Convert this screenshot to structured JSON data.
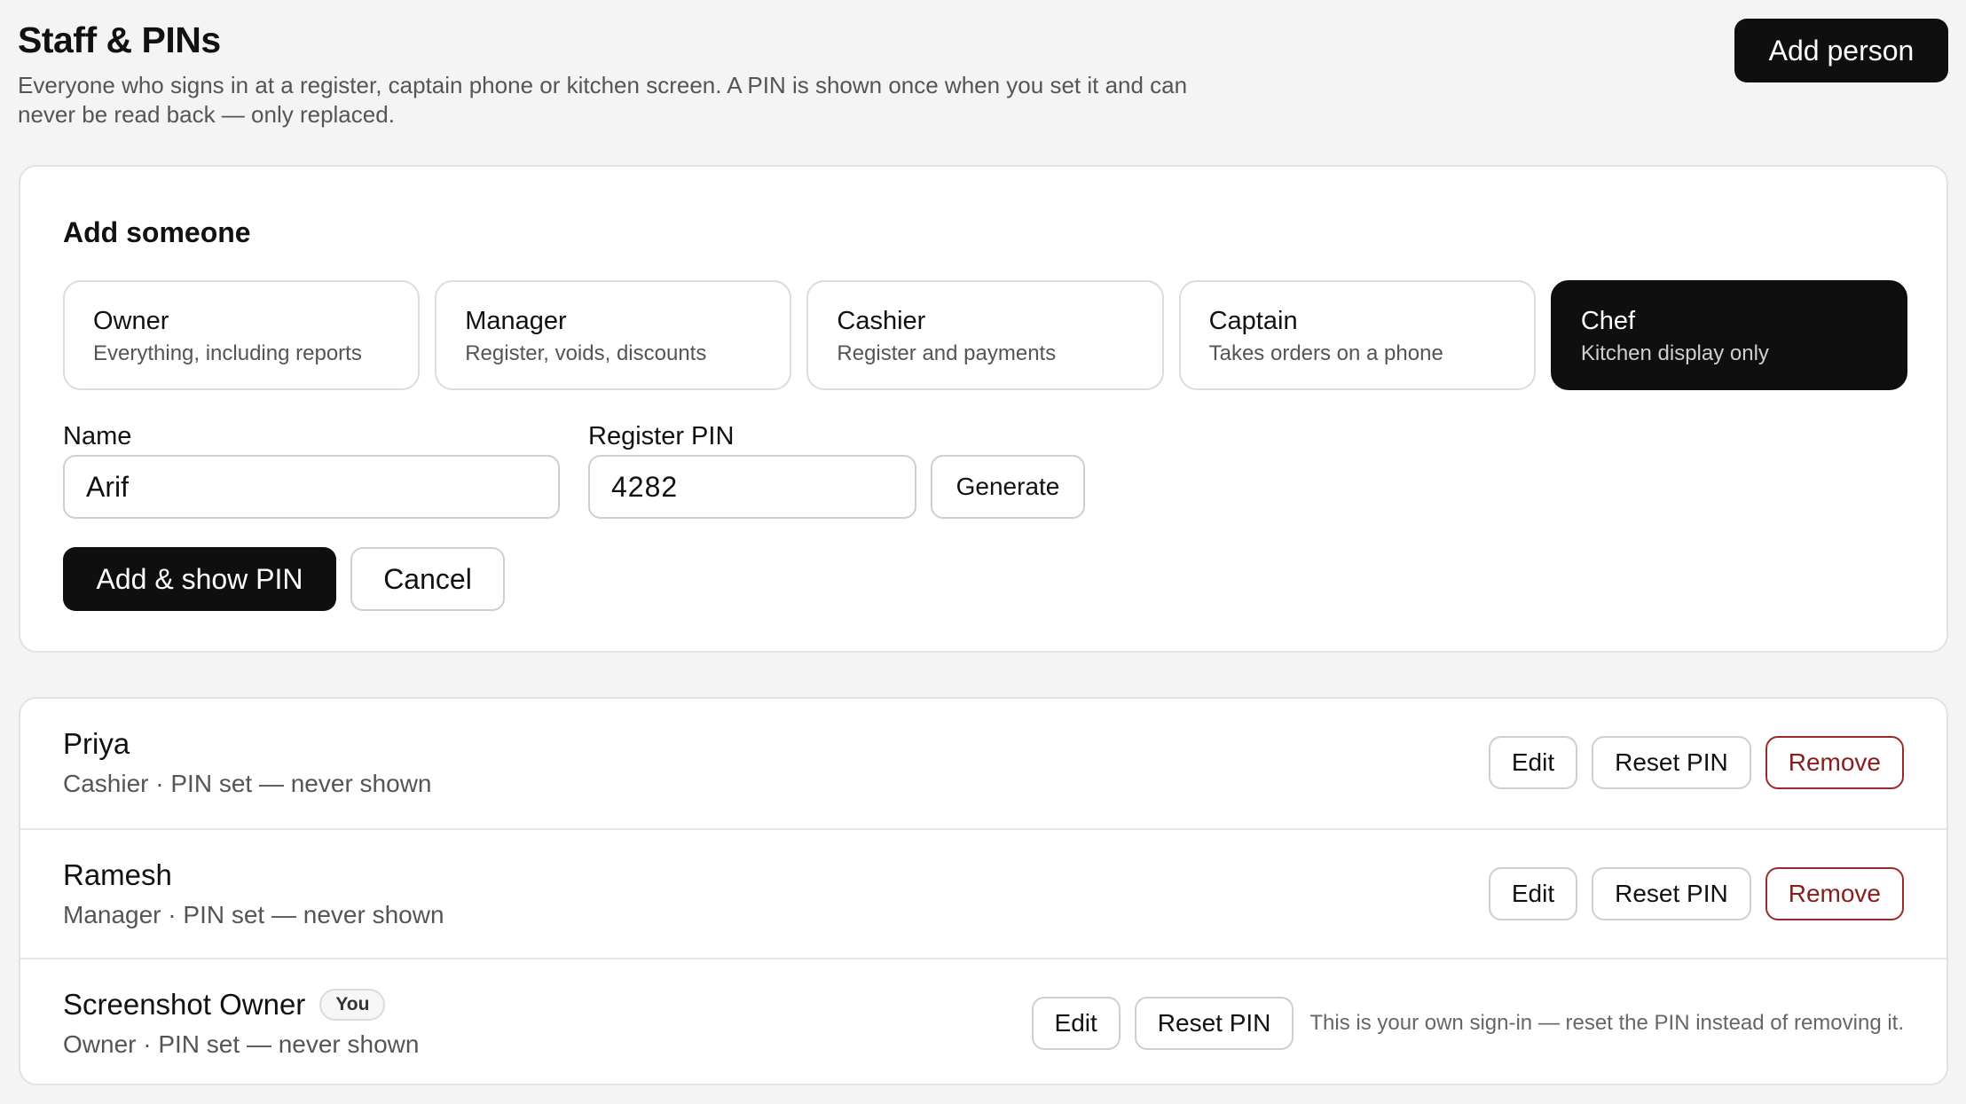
{
  "header": {
    "title": "Staff & PINs",
    "subtitle": "Everyone who signs in at a register, captain phone or kitchen screen. A PIN is shown once when you set it and can never be read back — only replaced.",
    "add_person_label": "Add person"
  },
  "add_form": {
    "title": "Add someone",
    "roles": [
      {
        "name": "Owner",
        "desc": "Everything, including reports",
        "selected": false
      },
      {
        "name": "Manager",
        "desc": "Register, voids, discounts",
        "selected": false
      },
      {
        "name": "Cashier",
        "desc": "Register and payments",
        "selected": false
      },
      {
        "name": "Captain",
        "desc": "Takes orders on a phone",
        "selected": false
      },
      {
        "name": "Chef",
        "desc": "Kitchen display only",
        "selected": true
      }
    ],
    "name_label": "Name",
    "name_value": "Arif",
    "pin_label": "Register PIN",
    "pin_value": "4282",
    "generate_label": "Generate",
    "submit_label": "Add & show PIN",
    "cancel_label": "Cancel"
  },
  "staff": [
    {
      "name": "Priya",
      "meta": "Cashier · PIN set — never shown",
      "edit": "Edit",
      "reset": "Reset PIN",
      "remove": "Remove"
    },
    {
      "name": "Ramesh",
      "meta": "Manager · PIN set — never shown",
      "edit": "Edit",
      "reset": "Reset PIN",
      "remove": "Remove"
    },
    {
      "name": "Screenshot Owner",
      "badge": "You",
      "meta": "Owner · PIN set — never shown",
      "edit": "Edit",
      "reset": "Reset PIN",
      "note": "This is your own sign-in — reset the PIN instead of removing it."
    }
  ],
  "colors": {
    "background": "#f4f4f4",
    "primary": "#0f0f0f",
    "danger": "#8a1c1c"
  }
}
